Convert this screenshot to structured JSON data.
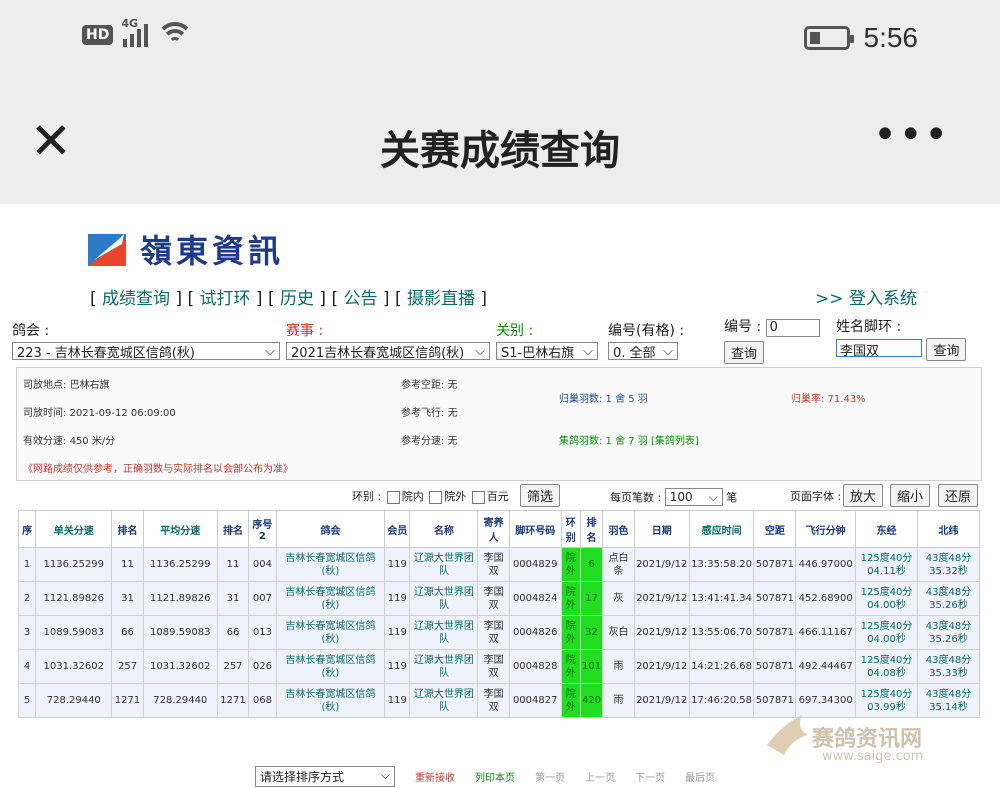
{
  "status": {
    "net": "HD",
    "gen": "4G",
    "time": "5:56"
  },
  "titlebar": {
    "close": "✕",
    "title": "关赛成绩查询",
    "more": "•••"
  },
  "logo": {
    "name": "嶺東資訊"
  },
  "nav": {
    "items": [
      "成绩查询",
      "试打环",
      "历史",
      "公告",
      "摄影直播"
    ],
    "login": ">> 登入系统"
  },
  "filters": {
    "club_label": "鸽会 :",
    "club_value": "223 - 吉林长春宽城区信鸽(秋)",
    "race_label": "赛事 :",
    "race_value": "2021吉林长春宽城区信鸽(秋)",
    "stage_label": "关别 :",
    "stage_value": "S1-巴林右旗",
    "num_label": "编号(有格) :",
    "num_value": "0. 全部",
    "id_label": "编号 :",
    "id_value": "0",
    "id_btn": "查询",
    "name_label": "姓名脚环 :",
    "name_value": "李国双",
    "name_btn": "查询"
  },
  "info": {
    "site_label": "司放地点:",
    "site": "巴林右旗",
    "time_label": "司放时间:",
    "time": "2021-09-12 06:09:00",
    "speed_label": "有效分速:",
    "speed": "450 米/分",
    "ref_dist_label": "参考空距:",
    "ref_dist": "无",
    "ref_fly_label": "参考飞行:",
    "ref_fly": "无",
    "ref_speed_label": "参考分速:",
    "ref_speed": "无",
    "home": "归巢羽数: 1 舍 5 羽",
    "home_rate": "归巢率: 71.43%",
    "collect": "集鸽羽数: 1 舍 7 羽",
    "collect_link": "[集鸽列表]",
    "notice": "《网路成绩仅供参考，正确羽数与实际排名以会部公布为准》"
  },
  "toolbar": {
    "ring_label": "环别 :",
    "opt1": "院内",
    "opt2": "院外",
    "opt3": "百元",
    "filter_btn": "筛选",
    "per_page_label": "每页笔数 :",
    "per_page": "100",
    "per_page_unit": "笔",
    "font_label": "页面字体 :",
    "zoom_in": "放大",
    "zoom_out": "缩小",
    "reset": "还原"
  },
  "table": {
    "headers": [
      "序",
      "单关分速",
      "排名",
      "平均分速",
      "排名",
      "序号2",
      "鸽会",
      "会员",
      "名称",
      "寄养人",
      "脚环号码",
      "环别",
      "排名",
      "羽色",
      "日期",
      "感应时间",
      "空距",
      "飞行分钟",
      "东经",
      "北纬"
    ],
    "rows": [
      [
        "1",
        "1136.25299",
        "11",
        "1136.25299",
        "11",
        "004",
        "吉林长春宽城区信鸽(秋)",
        "119",
        "辽源大世界团队",
        "李国双",
        "0004829",
        "院外",
        "6",
        "点白条",
        "2021/9/12",
        "13:35:58.20",
        "507871",
        "446.97000",
        "125度40分04.11秒",
        "43度48分35.32秒"
      ],
      [
        "2",
        "1121.89826",
        "31",
        "1121.89826",
        "31",
        "007",
        "吉林长春宽城区信鸽(秋)",
        "119",
        "辽源大世界团队",
        "李国双",
        "0004824",
        "院外",
        "17",
        "灰",
        "2021/9/12",
        "13:41:41.34",
        "507871",
        "452.68900",
        "125度40分04.00秒",
        "43度48分35.26秒"
      ],
      [
        "3",
        "1089.59083",
        "66",
        "1089.59083",
        "66",
        "013",
        "吉林长春宽城区信鸽(秋)",
        "119",
        "辽源大世界团队",
        "李国双",
        "0004826",
        "院外",
        "32",
        "灰白",
        "2021/9/12",
        "13:55:06.70",
        "507871",
        "466.11167",
        "125度40分04.00秒",
        "43度48分35.26秒"
      ],
      [
        "4",
        "1031.32602",
        "257",
        "1031.32602",
        "257",
        "026",
        "吉林长春宽城区信鸽(秋)",
        "119",
        "辽源大世界团队",
        "李国双",
        "0004828",
        "院外",
        "101",
        "雨",
        "2021/9/12",
        "14:21:26.68",
        "507871",
        "492.44467",
        "125度40分04.08秒",
        "43度48分35.33秒"
      ],
      [
        "5",
        "728.29440",
        "1271",
        "728.29440",
        "1271",
        "068",
        "吉林长春宽城区信鸽(秋)",
        "119",
        "辽源大世界团队",
        "李国双",
        "0004827",
        "院外",
        "420",
        "雨",
        "2021/9/12",
        "17:46:20.58",
        "507871",
        "697.34300",
        "125度40分03.99秒",
        "43度48分35.14秒"
      ]
    ]
  },
  "bottom": {
    "sort": "请选择排序方式",
    "reload": "重新接收",
    "print": "列印本页",
    "first": "第一页",
    "prev": "上一页",
    "next": "下一页",
    "last": "最后页"
  },
  "watermark": {
    "text": "赛鸽资讯网",
    "url": "www.saige.com"
  }
}
